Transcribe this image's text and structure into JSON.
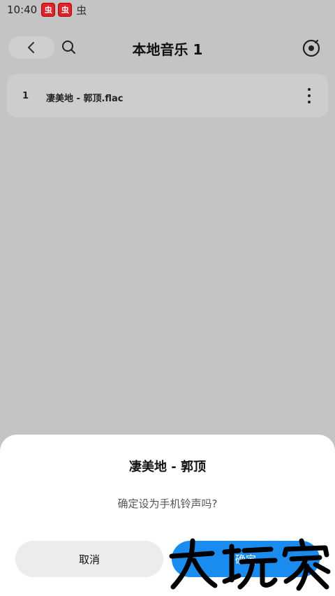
{
  "status_bar": {
    "time": "10:40",
    "badges": [
      "虫",
      "虫"
    ],
    "plain_icon": "虫"
  },
  "header": {
    "back_icon": "chevron-left-icon",
    "search_icon": "search-icon",
    "title": "本地音乐 1",
    "disc_icon": "music-disc-icon"
  },
  "songs": [
    {
      "index": "1",
      "title": "凄美地 - 郭顶.flac"
    }
  ],
  "dialog": {
    "title": "凄美地 - 郭顶",
    "message": "确定设为手机铃声吗?",
    "cancel_label": "取消",
    "confirm_label": "确定"
  },
  "watermark": {
    "text": "大玩家"
  },
  "colors": {
    "background": "#c4c4c4",
    "confirm_button": "#1a8cf0",
    "cancel_button": "#ececec",
    "badge": "#d9252b"
  }
}
